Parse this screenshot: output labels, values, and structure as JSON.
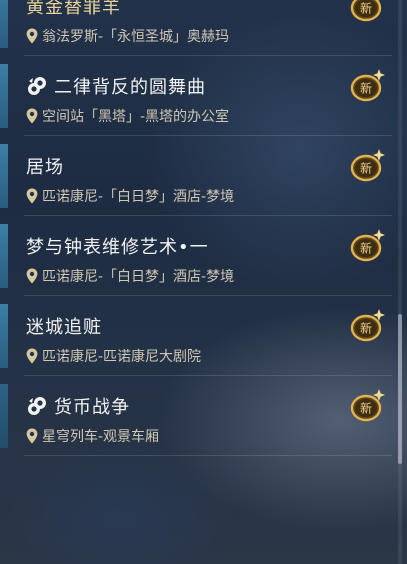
{
  "quests": [
    {
      "title": "黄金替罪羊",
      "location": "翁法罗斯-「永恒圣城」奥赫玛",
      "has_quest_icon": false,
      "badge": "新"
    },
    {
      "title": "二律背反的圆舞曲",
      "location": "空间站「黑塔」-黑塔的办公室",
      "has_quest_icon": true,
      "badge": "新"
    },
    {
      "title": "居场",
      "location": "匹诺康尼-「白日梦」酒店-梦境",
      "has_quest_icon": false,
      "badge": "新"
    },
    {
      "title": "梦与钟表维修艺术•一",
      "location": "匹诺康尼-「白日梦」酒店-梦境",
      "has_quest_icon": false,
      "badge": "新"
    },
    {
      "title": "迷城追赃",
      "location": "匹诺康尼-匹诺康尼大剧院",
      "has_quest_icon": false,
      "badge": "新"
    },
    {
      "title": "货币战争",
      "location": "星穹列车-观景车厢",
      "has_quest_icon": true,
      "badge": "新"
    }
  ],
  "colors": {
    "accent_bar": "#3d7fa6",
    "title_text": "#f2f2f2",
    "location_text": "#cfc7b3",
    "badge_gold": "#e3b150"
  }
}
